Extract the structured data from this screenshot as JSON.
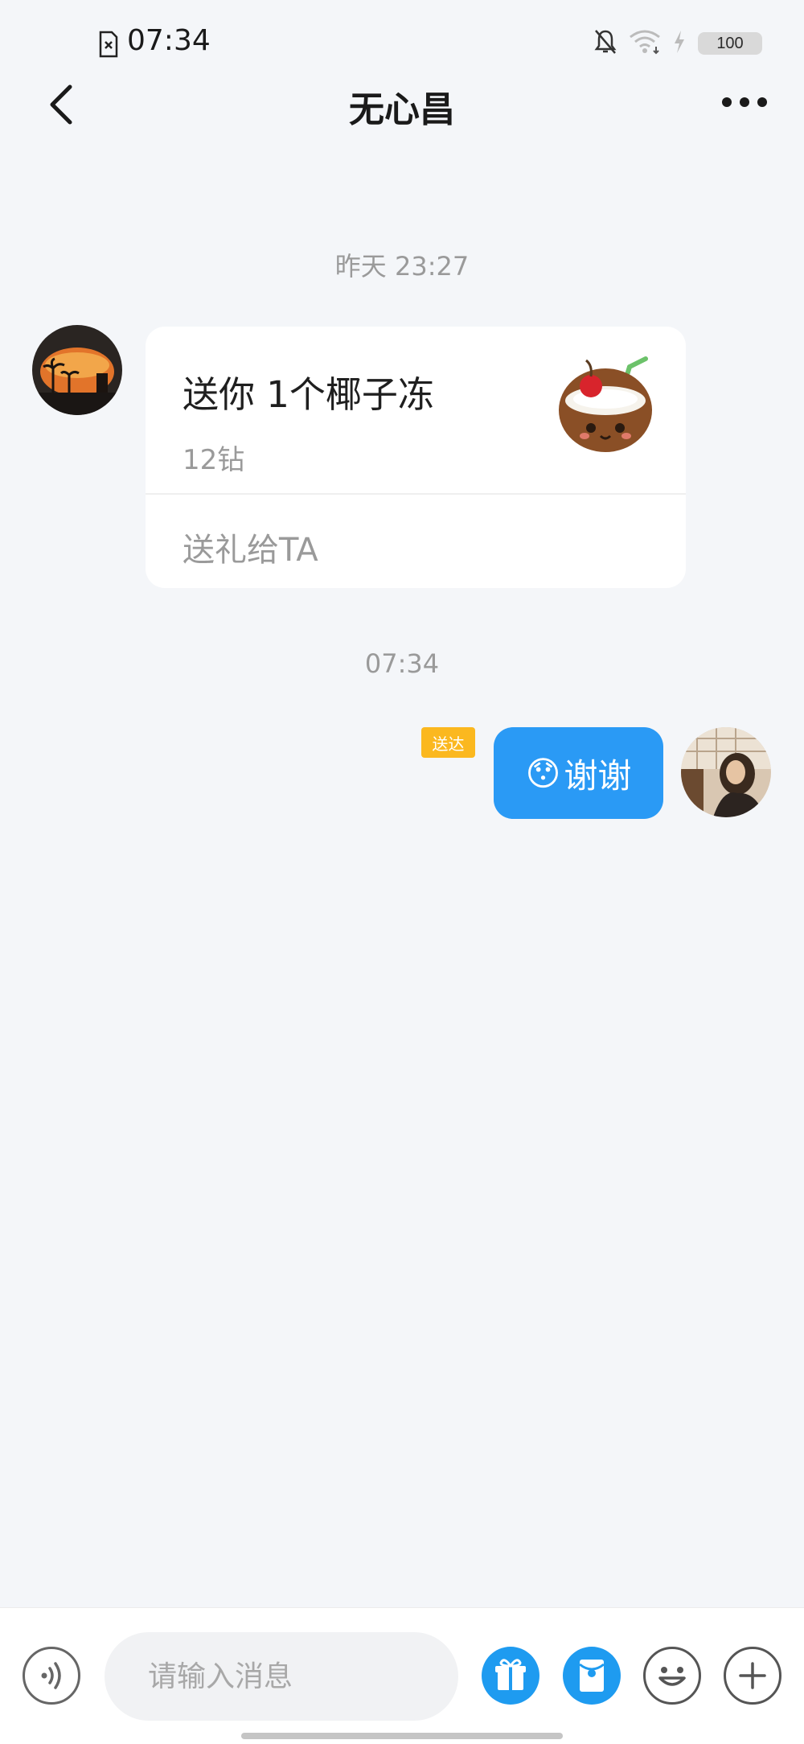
{
  "status_bar": {
    "time": "07:34",
    "battery": "100"
  },
  "header": {
    "title": "无心昌"
  },
  "messages": {
    "timestamp_1": "昨天 23:27",
    "gift_card": {
      "title": "送你 1个椰子冻",
      "price": "12钻",
      "action": "送礼给TA"
    },
    "timestamp_2": "07:34",
    "sent": {
      "status": "送达",
      "text": "谢谢",
      "emoji": "😯"
    }
  },
  "input_bar": {
    "placeholder": "请输入消息"
  },
  "colors": {
    "accent": "#2a9af5",
    "badge": "#fbb81f",
    "background": "#f4f6f9"
  }
}
